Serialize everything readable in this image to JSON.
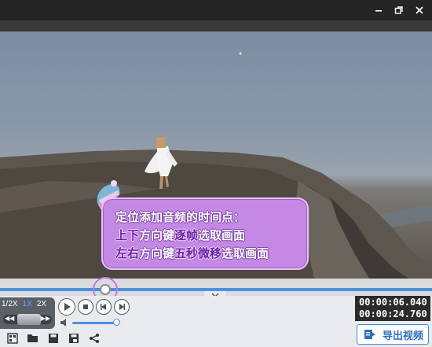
{
  "caption": {
    "line1": "定位添加音频的时间点：",
    "line2_a": "上下",
    "line2_b": "方向键",
    "line2_c": "逐帧",
    "line2_d": "选取画面",
    "line3_a": "左右",
    "line3_b": "方向键",
    "line3_c": "五秒微移",
    "line3_d": "选取画面"
  },
  "speed": {
    "options": [
      "1/2X",
      "1X",
      "2X"
    ],
    "selected": "1X"
  },
  "time": {
    "current": "00:00:06.040",
    "total": "00:00:24.760"
  },
  "playback": {
    "progress_fraction": 0.244,
    "volume_fraction": 1.0
  },
  "toolbar": {
    "export_label": "导出视频"
  },
  "colors": {
    "accent": "#4f8fe0",
    "bubble": "#c489e4",
    "highlight": "#6a22a3"
  },
  "icons": [
    "minimize-icon",
    "restore-icon",
    "close-icon",
    "play-icon",
    "stop-icon",
    "prev-frame-icon",
    "next-frame-icon",
    "volume-icon",
    "add-file-icon",
    "open-folder-icon",
    "save-icon",
    "save-as-icon",
    "share-icon",
    "export-icon"
  ]
}
